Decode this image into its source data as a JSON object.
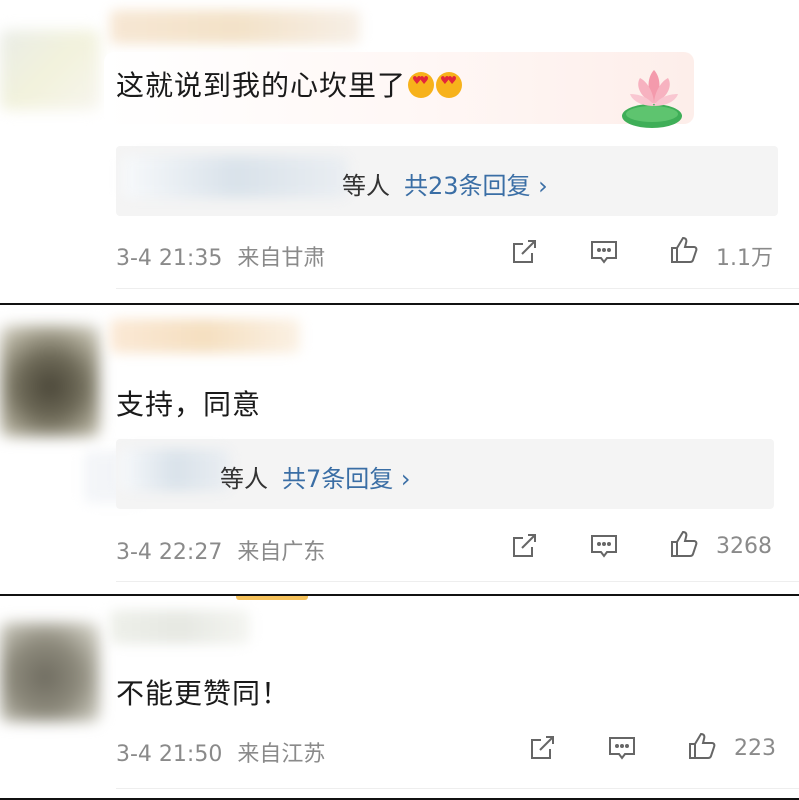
{
  "comments": [
    {
      "text": "这就说到我的心坎里了",
      "emoji_icons": [
        "heart-eyes-emoji",
        "heart-eyes-emoji"
      ],
      "replies": {
        "suffix": "等人",
        "count_label": "共23条回复 ›"
      },
      "time": "3-4 21:35",
      "location": "来自甘肃",
      "likes": "1.1万",
      "actions": [
        "share-icon",
        "comment-icon",
        "like-icon"
      ]
    },
    {
      "text": "支持，同意",
      "replies": {
        "suffix": "等人",
        "count_label": "共7条回复 ›"
      },
      "time": "3-4 22:27",
      "location": "来自广东",
      "likes": "3268",
      "actions": [
        "share-icon",
        "comment-icon",
        "like-icon"
      ]
    },
    {
      "text": "不能更赞同！",
      "time": "3-4 21:50",
      "location": "来自江苏",
      "likes": "223",
      "actions": [
        "share-icon",
        "comment-icon",
        "like-icon"
      ]
    }
  ],
  "colors": {
    "reply_link": "#3a6ea5",
    "meta_text": "#8a8a8a",
    "reply_background": "#f4f4f4",
    "comment_text": "#1a1a1a"
  }
}
